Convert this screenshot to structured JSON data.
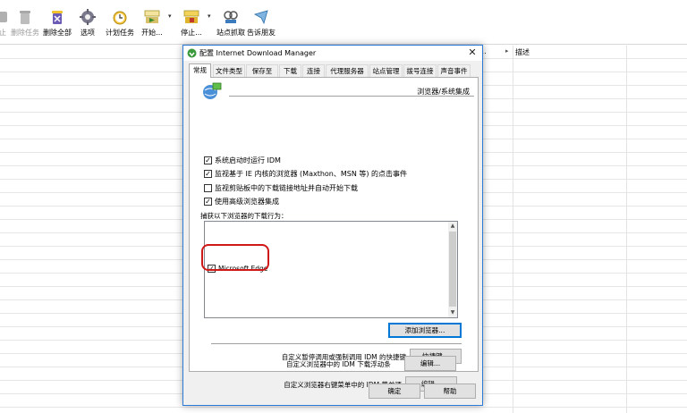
{
  "toolbar": {
    "items": [
      {
        "label": "止",
        "icon": "stop-icon",
        "disabled": true
      },
      {
        "label": "删除任务",
        "icon": "delete-task-icon",
        "disabled": true
      },
      {
        "label": "删除全部",
        "icon": "delete-all-icon",
        "disabled": false
      },
      {
        "label": "选项",
        "icon": "options-gear-icon",
        "disabled": false
      },
      {
        "label": "计划任务",
        "icon": "scheduler-clock-icon",
        "disabled": false
      },
      {
        "label": "开始...",
        "icon": "start-queue-icon",
        "disabled": false
      },
      {
        "label": "停止...",
        "icon": "stop-queue-icon",
        "disabled": false
      },
      {
        "label": "站点抓取",
        "icon": "site-grabber-icon",
        "disabled": false
      },
      {
        "label": "告诉朋友",
        "icon": "tell-friend-icon",
        "disabled": false
      }
    ]
  },
  "list_header": {
    "left_fragment": "...",
    "description": "描述"
  },
  "dialog": {
    "title": "配置 Internet Download Manager",
    "tabs": [
      "常规",
      "文件类型",
      "保存至",
      "下载",
      "连接",
      "代理服务器",
      "站点管理",
      "拨号连接",
      "声音事件"
    ],
    "active_tab": "常规",
    "section_title": "浏览器/系统集成",
    "checkboxes": [
      {
        "label": "系统启动时运行 IDM",
        "checked": true
      },
      {
        "label": "监视基于 IE 内核的浏览器 (Maxthon、MSN 等) 的点击事件",
        "checked": true
      },
      {
        "label": "监视剪贴板中的下载链接地址并自动开始下载",
        "checked": false
      },
      {
        "label": "使用高级浏览器集成",
        "checked": true
      }
    ],
    "capture_label": "捕获以下浏览器的下载行为：",
    "browsers": [
      {
        "label": "Microsoft Edge",
        "checked": true
      }
    ],
    "add_browser_button": "添加浏览器...",
    "hotkey_label": "自定义暂停调用或强制调用 IDM 的快捷键",
    "hotkey_button": "快捷键...",
    "context_menu_label": "自定义浏览器右键菜单中的 IDM 菜单项",
    "context_menu_button": "编辑...",
    "float_bar_label": "自定义浏览器中的 IDM 下载浮动条",
    "float_bar_button": "编辑...",
    "ok_button": "确定",
    "help_button": "帮助"
  },
  "colors": {
    "accent": "#0078d7",
    "highlight_ring": "#d11818",
    "dialog_border": "#2b7bd6"
  }
}
